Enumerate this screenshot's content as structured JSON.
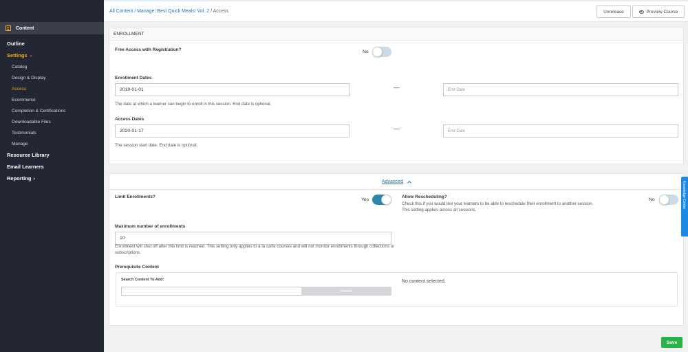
{
  "sidebar": {
    "content_label": "Content",
    "items": [
      {
        "label": "Outline"
      },
      {
        "label": "Settings"
      },
      {
        "label": "Resource Library"
      },
      {
        "label": "Email Learners"
      },
      {
        "label": "Reporting"
      }
    ],
    "settings_sub": [
      "Catalog",
      "Design & Display",
      "Access",
      "Ecommerce",
      "Completion & Certifications",
      "Downloadable Files",
      "Testimonials",
      "Manage"
    ]
  },
  "header": {
    "crumb_all": "All Content",
    "crumb_manage": "Manage: Best Quick Meals! Vol. 2",
    "crumb_current": "Access",
    "unrelease_label": "Unrelease",
    "preview_label": "Preview Course"
  },
  "enrollment": {
    "title": "ENROLLMENT",
    "free_access_label": "Free Access with Registration?",
    "free_access_value": "No",
    "enrollment_dates_label": "Enrollment Dates",
    "enrollment_start": "2019-01-01",
    "enrollment_end_placeholder": "End Date",
    "enrollment_help": "The date at which a learner can begin to enroll in this session. End date is optional.",
    "access_dates_label": "Access Dates",
    "access_start": "2020-01-17",
    "access_end_placeholder": "End Date",
    "access_help": "The session start date. End date is optional.",
    "dash": "—"
  },
  "advanced": {
    "toggle_label": "Advanced",
    "limit_label": "Limit Enrollments?",
    "limit_value": "Yes",
    "resched_label": "Allow Rescheduling?",
    "resched_value": "No",
    "resched_help": "Check this if you would like your learners to be able to reschedule their enrollment to another session. This setting applies across all sessions.",
    "max_label": "Maximum number of enrollments",
    "max_value": "10",
    "max_help": "Enrollment will shut off after this limit is reached. This setting only applies to a la carte courses and will not monitor enrollments through collections or subscriptions.",
    "prereq_label": "Prerequisite Content",
    "search_label": "Search Content To Add:",
    "search_button": "Search",
    "no_content": "No content selected."
  },
  "footer": {
    "save_label": "Save"
  },
  "side_tab": {
    "label": "Knowledge Center"
  },
  "colors": {
    "accent": "#f5a623",
    "link": "#1a73c9",
    "save": "#2bb34a",
    "toggle_on": "#2b87b0",
    "sidebar_bg": "#232733"
  }
}
